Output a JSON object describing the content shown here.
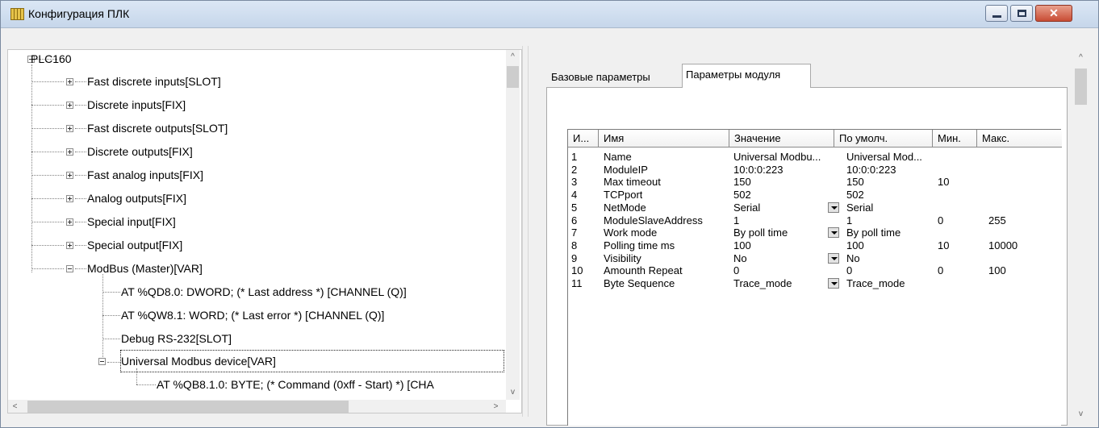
{
  "window": {
    "title": "Конфигурация ПЛК",
    "close_glyph": "✕"
  },
  "tree": {
    "root": "PLC160",
    "items": [
      "Fast discrete inputs[SLOT]",
      "Discrete inputs[FIX]",
      "Fast discrete outputs[SLOT]",
      "Discrete outputs[FIX]",
      "Fast analog inputs[FIX]",
      "Analog outputs[FIX]",
      "Special input[FIX]",
      "Special output[FIX]",
      "ModBus (Master)[VAR]"
    ],
    "modbus_children": [
      "AT %QD8.0: DWORD; (* Last address *) [CHANNEL (Q)]",
      "AT %QW8.1: WORD; (* Last error *) [CHANNEL (Q)]",
      "Debug RS-232[SLOT]",
      "Universal Modbus device[VAR]"
    ],
    "device_child": "AT %QB8.1.0: BYTE; (* Command (0xff - Start) *) [CHA"
  },
  "scroll": {
    "up": "^",
    "down": "v",
    "left": "<",
    "right": ">"
  },
  "tabs": {
    "base": "Базовые параметры",
    "module": "Параметры модуля"
  },
  "grid": {
    "headers": [
      "И...",
      "Имя",
      "Значение",
      "По умолч.",
      "Мин.",
      "Макс."
    ],
    "rows": [
      {
        "id": "1",
        "name": "Name",
        "value": "Universal Modbu...",
        "default": "Universal Mod...",
        "min": "",
        "max": "",
        "dropdown": false
      },
      {
        "id": "2",
        "name": "ModuleIP",
        "value": "10:0:0:223",
        "default": "10:0:0:223",
        "min": "",
        "max": "",
        "dropdown": false
      },
      {
        "id": "3",
        "name": "Max timeout",
        "value": "150",
        "default": "150",
        "min": "10",
        "max": "",
        "dropdown": false
      },
      {
        "id": "4",
        "name": "TCPport",
        "value": "502",
        "default": "502",
        "min": "",
        "max": "",
        "dropdown": false
      },
      {
        "id": "5",
        "name": "NetMode",
        "value": "Serial",
        "default": "Serial",
        "min": "",
        "max": "",
        "dropdown": true
      },
      {
        "id": "6",
        "name": "ModuleSlaveAddress",
        "value": "1",
        "default": "1",
        "min": "0",
        "max": "255",
        "dropdown": false
      },
      {
        "id": "7",
        "name": "Work mode",
        "value": "By poll time",
        "default": "By poll time",
        "min": "",
        "max": "",
        "dropdown": true
      },
      {
        "id": "8",
        "name": "Polling time ms",
        "value": "100",
        "default": "100",
        "min": "10",
        "max": "10000",
        "dropdown": false
      },
      {
        "id": "9",
        "name": "Visibility",
        "value": "No",
        "default": "No",
        "min": "",
        "max": "",
        "dropdown": true
      },
      {
        "id": "10",
        "name": "Amounth Repeat",
        "value": "0",
        "default": "0",
        "min": "0",
        "max": "100",
        "dropdown": false
      },
      {
        "id": "11",
        "name": "Byte Sequence",
        "value": "Trace_mode",
        "default": "Trace_mode",
        "min": "",
        "max": "",
        "dropdown": true
      }
    ]
  }
}
